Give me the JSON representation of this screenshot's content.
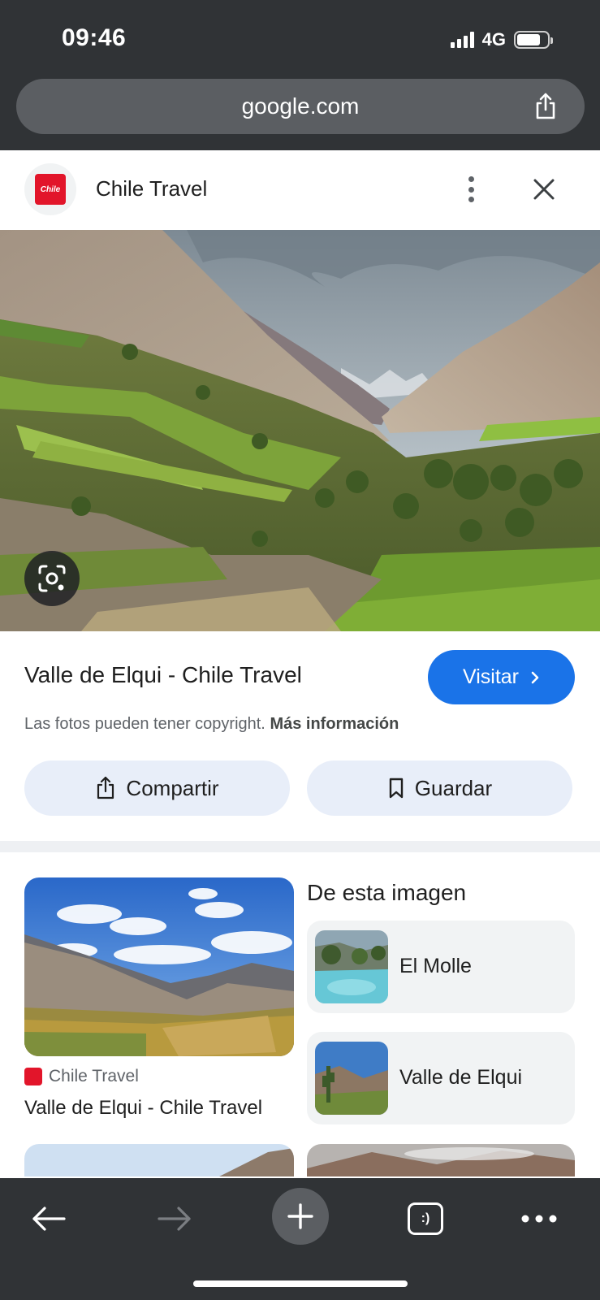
{
  "status_bar": {
    "time": "09:46",
    "network": "4G",
    "battery_level": 0.7
  },
  "browser": {
    "url": "google.com",
    "share_icon": "share-icon"
  },
  "sheet": {
    "site_name": "Chile Travel",
    "site_logo_text": "Chile",
    "menu_icon": "more-vert-icon",
    "close_icon": "close-icon"
  },
  "hero": {
    "lens_icon": "lens-icon"
  },
  "result": {
    "title": "Valle de Elqui - Chile Travel",
    "visit_label": "Visitar",
    "copyright_text": "Las fotos pueden tener copyright.",
    "copyright_link": "Más información",
    "share_label": "Compartir",
    "save_label": "Guardar"
  },
  "related": {
    "card": {
      "source": "Chile Travel",
      "caption": "Valle de Elqui - Chile Travel"
    },
    "from_image_heading": "De esta imagen",
    "entities": [
      {
        "label": "El Molle"
      },
      {
        "label": "Valle de Elqui"
      }
    ]
  },
  "toolbar": {
    "tab_count_glyph": ":)"
  },
  "colors": {
    "chrome": "#303336",
    "accent": "#1a73e8",
    "pill": "#e8eef9",
    "brand_red": "#e2152a"
  }
}
